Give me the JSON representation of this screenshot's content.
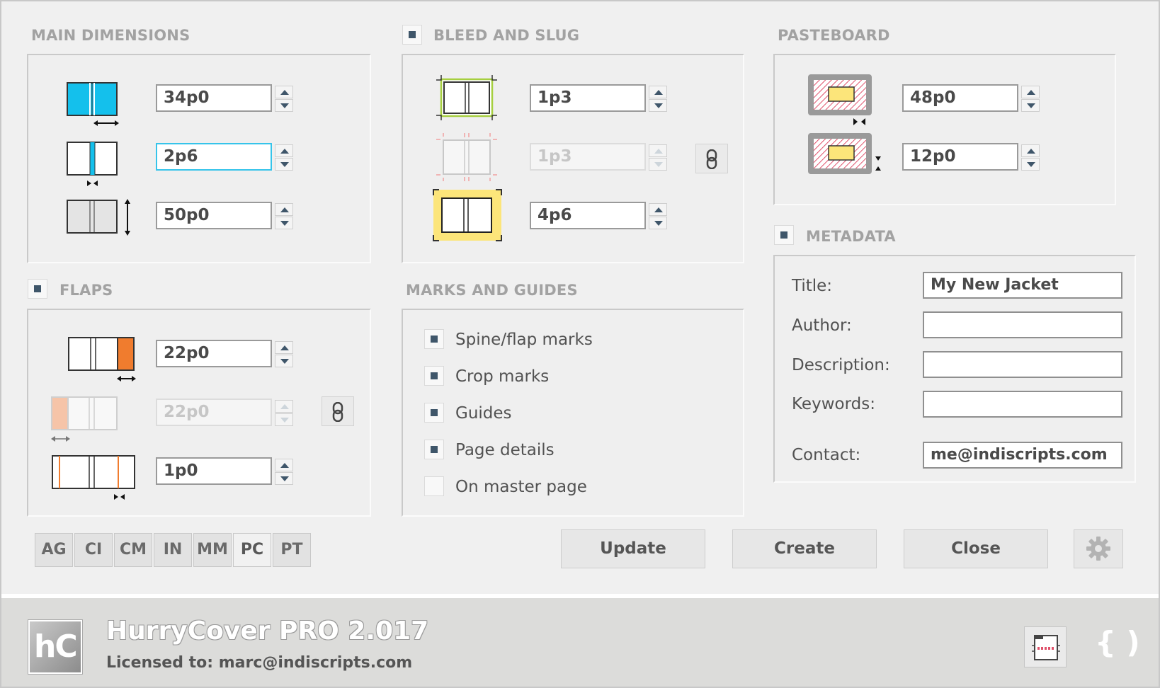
{
  "sections": {
    "main_dimensions": "MAIN DIMENSIONS",
    "bleed_and_slug": "BLEED AND SLUG",
    "pasteboard": "PASTEBOARD",
    "flaps": "FLAPS",
    "marks_and_guides": "MARKS AND GUIDES",
    "metadata": "METADATA"
  },
  "main_dimensions": {
    "cover_width": "34p0",
    "spine_width": "2p6",
    "height": "50p0"
  },
  "bleed_and_slug": {
    "enabled": true,
    "bleed": "1p3",
    "bleed_linked": "1p3",
    "slug": "4p6"
  },
  "pasteboard": {
    "horizontal": "48p0",
    "vertical": "12p0"
  },
  "flaps": {
    "enabled": true,
    "right_flap": "22p0",
    "left_flap": "22p0",
    "fold_offset": "1p0"
  },
  "marks": [
    {
      "label": "Spine/flap marks",
      "checked": true
    },
    {
      "label": "Crop marks",
      "checked": true
    },
    {
      "label": "Guides",
      "checked": true
    },
    {
      "label": "Page details",
      "checked": true
    },
    {
      "label": "On master page",
      "checked": false
    }
  ],
  "metadata": {
    "enabled": true,
    "title_label": "Title:",
    "title": "My New Jacket",
    "author_label": "Author:",
    "author": "",
    "description_label": "Description:",
    "description": "",
    "keywords_label": "Keywords:",
    "keywords": "",
    "contact_label": "Contact:",
    "contact": "me@indiscripts.com"
  },
  "units": [
    "AG",
    "CI",
    "CM",
    "IN",
    "MM",
    "PC",
    "PT"
  ],
  "selected_unit": "PC",
  "buttons": {
    "update": "Update",
    "create": "Create",
    "close": "Close"
  },
  "footer": {
    "logo_text": "hC",
    "product": "HurryCover PRO 2.017",
    "license": "Licensed to: marc@indiscripts.com",
    "brand_mark": "{ )"
  },
  "colors": {
    "accent": "#36c4ea",
    "checkbox": "#3f566a",
    "flap": "#f07c2e",
    "slug": "#fce57a",
    "bleed": "#a6cf3f"
  }
}
